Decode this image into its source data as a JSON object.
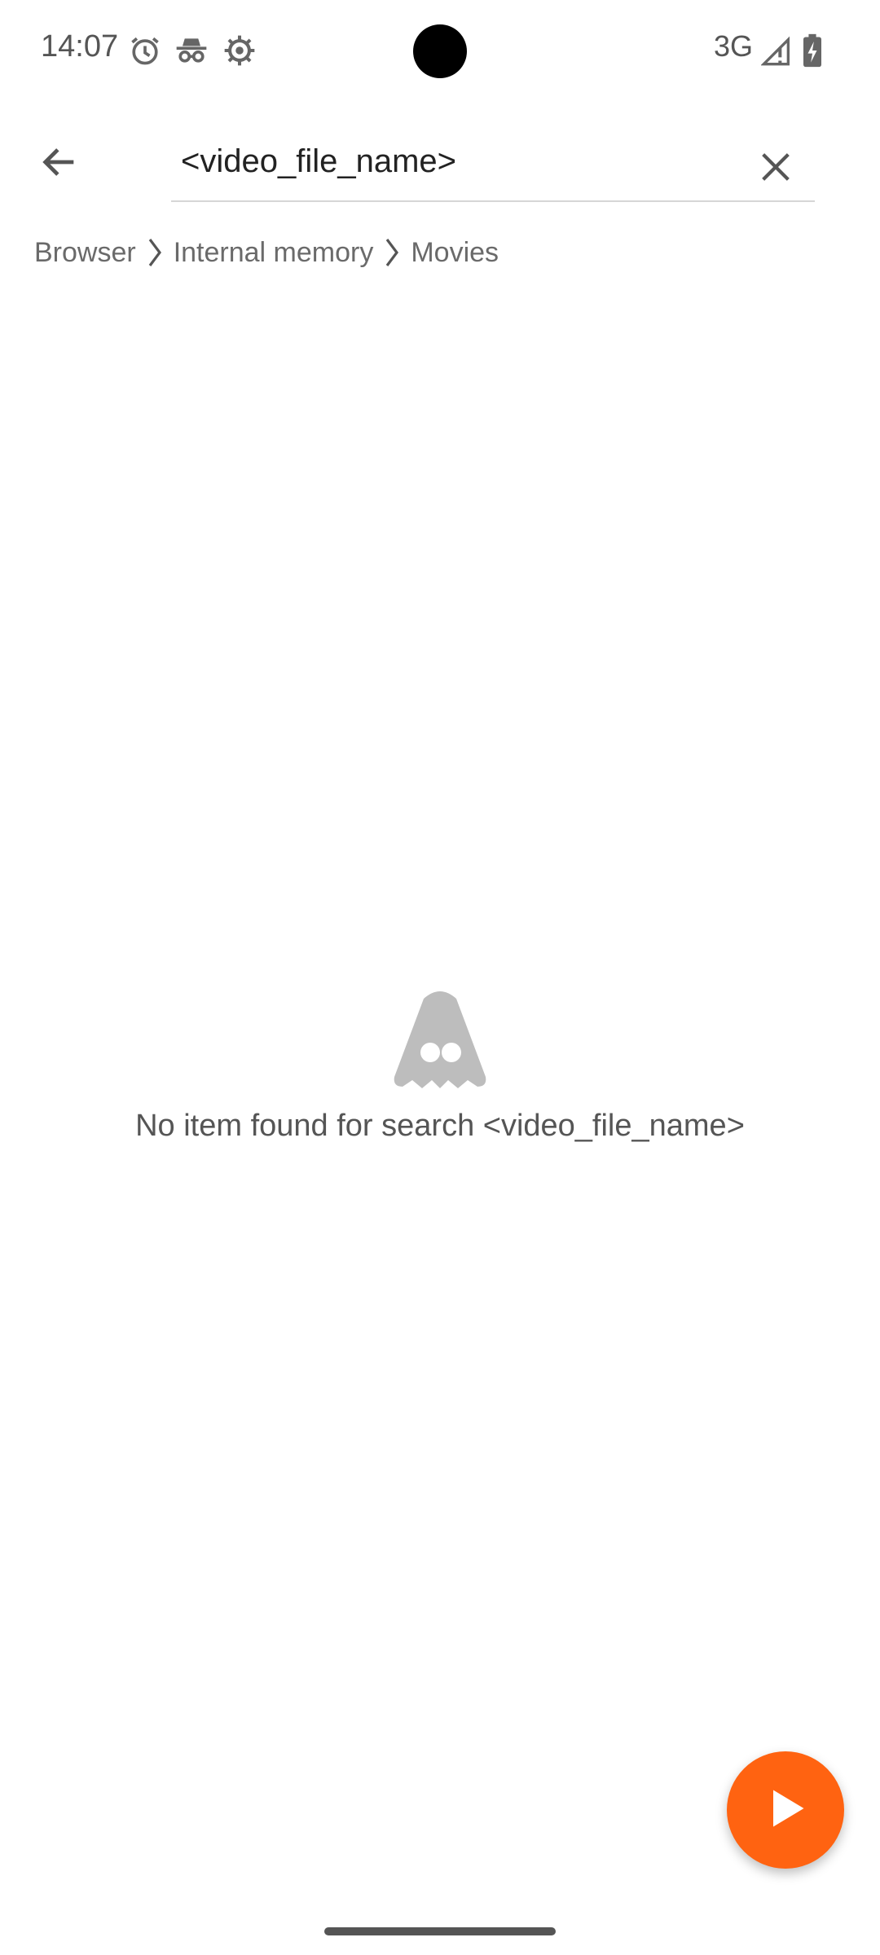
{
  "status_bar": {
    "time": "14:07",
    "icons": [
      "alarm-icon",
      "incognito-icon",
      "settings-gear-icon"
    ],
    "network": "3G",
    "signal": "signal-icon",
    "battery": "battery-charging-icon"
  },
  "app_bar": {
    "back_icon": "arrow-back-icon",
    "search": {
      "value": "<video_file_name>",
      "placeholder": ""
    },
    "clear_icon": "close-icon"
  },
  "breadcrumb": {
    "items": [
      "Browser",
      "Internal memory",
      "Movies"
    ],
    "separator_icon": "chevron-right-icon"
  },
  "empty_state": {
    "icon": "vlc-cone-ghost-icon",
    "message": "No item found for search <video_file_name>"
  },
  "fab": {
    "icon": "play-icon",
    "color": "#ff6311"
  }
}
